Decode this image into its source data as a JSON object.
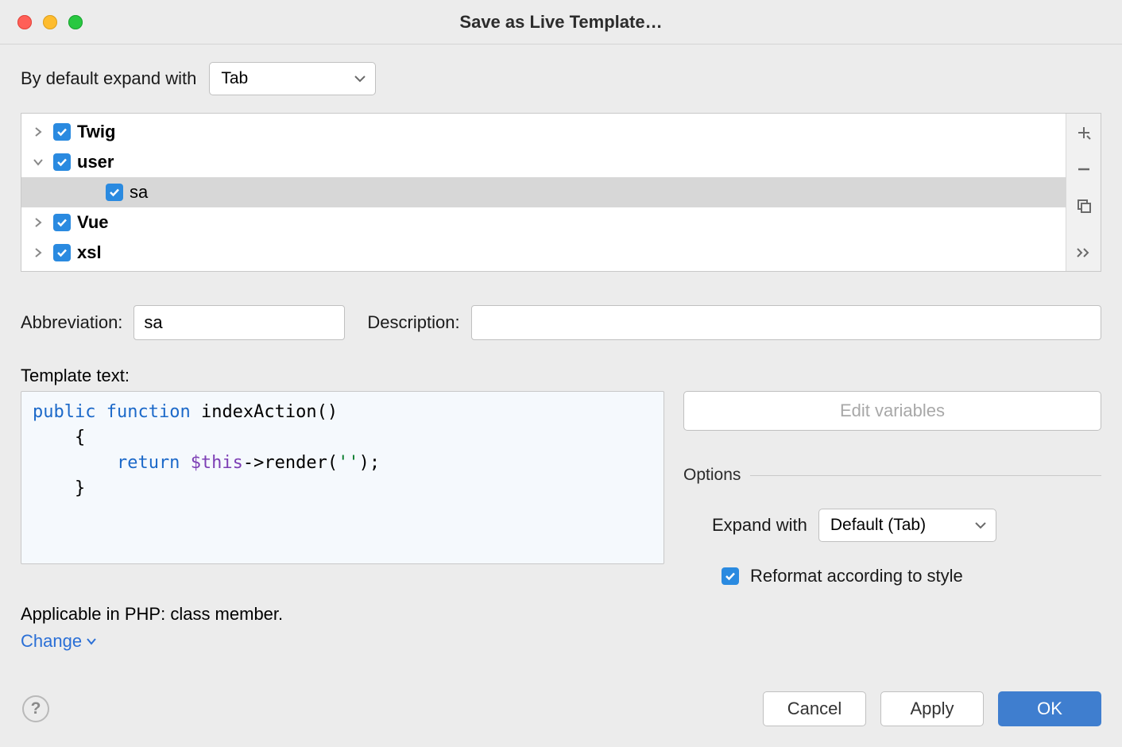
{
  "title": "Save as Live Template…",
  "expand_label": "By default expand with",
  "expand_default_value": "Tab",
  "tree": {
    "items": [
      {
        "label": "Twig",
        "expanded": false,
        "checked": true,
        "group": true
      },
      {
        "label": "user",
        "expanded": true,
        "checked": true,
        "group": true
      },
      {
        "label": "sa",
        "child": true,
        "checked": true,
        "group": false
      },
      {
        "label": "Vue",
        "expanded": false,
        "checked": true,
        "group": true
      },
      {
        "label": "xsl",
        "expanded": false,
        "checked": true,
        "group": true
      }
    ]
  },
  "abbr_label": "Abbreviation:",
  "abbr_value": "sa",
  "desc_label": "Description:",
  "desc_value": "",
  "template_label": "Template text:",
  "code": {
    "kw1": "public",
    "kw2": "function",
    "fn": " indexAction()",
    "open": "    {",
    "ret": "        return ",
    "this": "$this",
    "after": "->render(",
    "str": "''",
    "end": ");",
    "close": "    }"
  },
  "edit_vars": "Edit variables",
  "options_title": "Options",
  "expand_with_label": "Expand with",
  "expand_with_value": "Default (Tab)",
  "reformat_checked": true,
  "reformat_label": "Reformat according to style",
  "applicable": "Applicable in PHP: class member.",
  "change": "Change",
  "buttons": {
    "cancel": "Cancel",
    "apply": "Apply",
    "ok": "OK"
  }
}
